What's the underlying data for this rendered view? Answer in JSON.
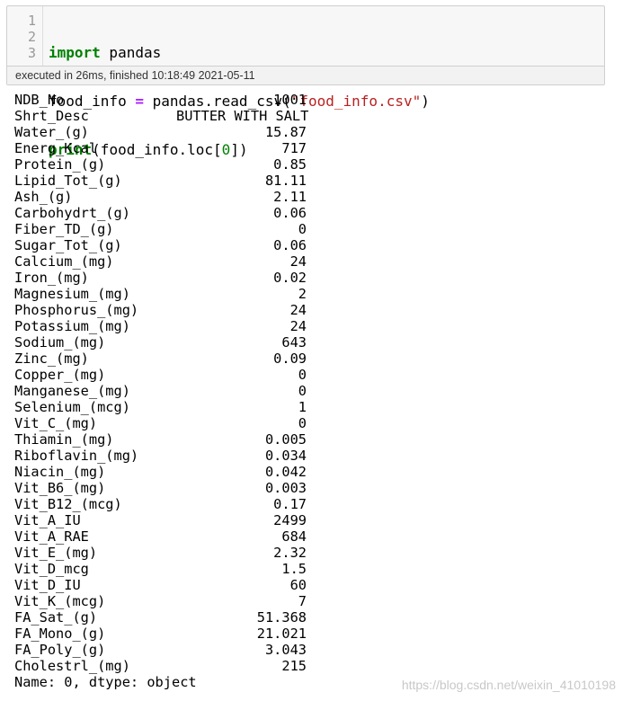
{
  "cell": {
    "gutter": [
      "1",
      "2",
      "3"
    ],
    "code": {
      "line1": {
        "kw": "import",
        "rest": " pandas"
      },
      "line2": {
        "a": "food_info ",
        "op": "=",
        "b": " pandas.read_csv(",
        "str": "\"food_info.csv\"",
        "c": ")"
      },
      "line3": {
        "kw": "print",
        "a": "(food_info.loc[",
        "num": "0",
        "b": "])"
      }
    },
    "exec_status": "executed in 26ms, finished 10:18:49 2021-05-11"
  },
  "output": {
    "rows": [
      {
        "key": "NDB_No",
        "value": "1001"
      },
      {
        "key": "Shrt_Desc",
        "value": "BUTTER WITH SALT"
      },
      {
        "key": "Water_(g)",
        "value": "15.87"
      },
      {
        "key": "Energ_Kcal",
        "value": "717"
      },
      {
        "key": "Protein_(g)",
        "value": "0.85"
      },
      {
        "key": "Lipid_Tot_(g)",
        "value": "81.11"
      },
      {
        "key": "Ash_(g)",
        "value": "2.11"
      },
      {
        "key": "Carbohydrt_(g)",
        "value": "0.06"
      },
      {
        "key": "Fiber_TD_(g)",
        "value": "0"
      },
      {
        "key": "Sugar_Tot_(g)",
        "value": "0.06"
      },
      {
        "key": "Calcium_(mg)",
        "value": "24"
      },
      {
        "key": "Iron_(mg)",
        "value": "0.02"
      },
      {
        "key": "Magnesium_(mg)",
        "value": "2"
      },
      {
        "key": "Phosphorus_(mg)",
        "value": "24"
      },
      {
        "key": "Potassium_(mg)",
        "value": "24"
      },
      {
        "key": "Sodium_(mg)",
        "value": "643"
      },
      {
        "key": "Zinc_(mg)",
        "value": "0.09"
      },
      {
        "key": "Copper_(mg)",
        "value": "0"
      },
      {
        "key": "Manganese_(mg)",
        "value": "0"
      },
      {
        "key": "Selenium_(mcg)",
        "value": "1"
      },
      {
        "key": "Vit_C_(mg)",
        "value": "0"
      },
      {
        "key": "Thiamin_(mg)",
        "value": "0.005"
      },
      {
        "key": "Riboflavin_(mg)",
        "value": "0.034"
      },
      {
        "key": "Niacin_(mg)",
        "value": "0.042"
      },
      {
        "key": "Vit_B6_(mg)",
        "value": "0.003"
      },
      {
        "key": "Vit_B12_(mcg)",
        "value": "0.17"
      },
      {
        "key": "Vit_A_IU",
        "value": "2499"
      },
      {
        "key": "Vit_A_RAE",
        "value": "684"
      },
      {
        "key": "Vit_E_(mg)",
        "value": "2.32"
      },
      {
        "key": "Vit_D_mcg",
        "value": "1.5"
      },
      {
        "key": "Vit_D_IU",
        "value": "60"
      },
      {
        "key": "Vit_K_(mcg)",
        "value": "7"
      },
      {
        "key": "FA_Sat_(g)",
        "value": "51.368"
      },
      {
        "key": "FA_Mono_(g)",
        "value": "21.021"
      },
      {
        "key": "FA_Poly_(g)",
        "value": "3.043"
      },
      {
        "key": "Cholestrl_(mg)",
        "value": "215"
      }
    ],
    "footer": "Name: 0, dtype: object"
  },
  "watermark": "https://blog.csdn.net/weixin_41010198",
  "colors": {
    "keyword": "#008000",
    "operator": "#aa22ff",
    "string": "#ba2121",
    "gutter_text": "#999999",
    "cell_background": "#f7f7f7"
  }
}
